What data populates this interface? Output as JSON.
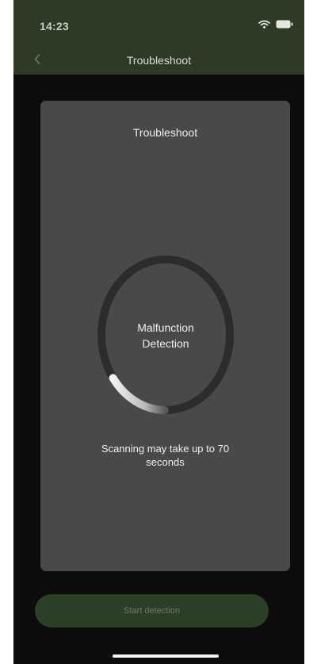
{
  "status_bar": {
    "time": "14:23",
    "icons": [
      "wifi-icon",
      "battery-icon"
    ]
  },
  "nav": {
    "title": "Troubleshoot",
    "back_icon": "chevron-left-icon"
  },
  "card": {
    "title": "Troubleshoot",
    "ring_label_line1": "Malfunction",
    "ring_label_line2": "Detection",
    "progress": 0.15,
    "scan_note_line1": "Scanning may take up to 70",
    "scan_note_line2": "seconds"
  },
  "actions": {
    "start_label": "Start detection"
  },
  "colors": {
    "header_bg": "#2f3a26",
    "screen_bg": "#0d0b0b",
    "card_bg": "#4a4949",
    "ring_track": "#2c2c2c",
    "ring_progress": "#d8d8d8",
    "button_bg": "#2b3f27",
    "button_text": "#6d7a67"
  }
}
